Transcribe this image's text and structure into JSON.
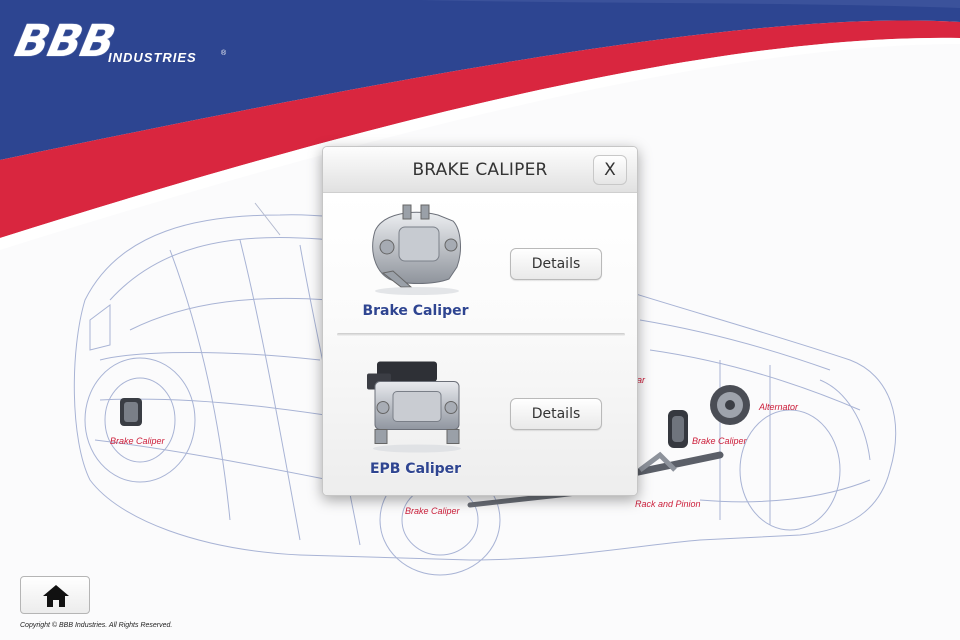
{
  "brand": {
    "logo_main": "BBB",
    "logo_sub": "INDUSTRIES",
    "logo_reg": "®",
    "colors": {
      "blue": "#2d4591",
      "red": "#d9263f",
      "label_red": "#cc1e3a",
      "title_blue": "#2f4591"
    }
  },
  "car_labels": {
    "brake_caliper_rear": "Brake Caliper",
    "brake_caliper_center": "Brake Caliper",
    "brake_caliper_front": "Brake Caliper",
    "alternator": "Alternator",
    "rack_and_pinion": "Rack and Pinion",
    "partial_label": "ar"
  },
  "modal": {
    "title": "BRAKE CALIPER",
    "close_label": "X",
    "items": [
      {
        "label": "Brake Caliper",
        "button": "Details",
        "icon": "brake-caliper-icon"
      },
      {
        "label": "EPB Caliper",
        "button": "Details",
        "icon": "epb-caliper-icon"
      }
    ]
  },
  "footer": {
    "home_icon": "home-icon",
    "copyright": "Copyright © BBB Industries.  All Rights Reserved."
  }
}
